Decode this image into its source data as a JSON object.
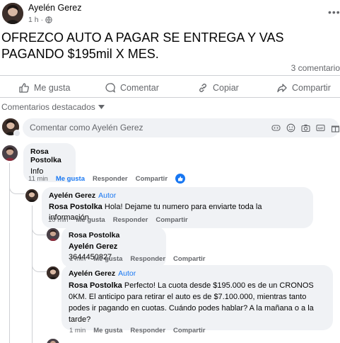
{
  "post": {
    "author": "Ayelén Gerez",
    "time": "1 h",
    "time_separator": "·",
    "text": "OFREZCO AUTO A PAGAR SE ENTREGA Y VAS PAGANDO $195mil X MES.",
    "comment_count": "3 comentario"
  },
  "actions": {
    "like": "Me gusta",
    "comment": "Comentar",
    "copy": "Copiar",
    "share": "Compartir"
  },
  "featured_label": "Comentarios destacados",
  "comment_input": {
    "placeholder": "Comentar como Ayelén Gerez",
    "icons": [
      "sticker-icon",
      "emoji-icon",
      "camera-icon",
      "gif-icon",
      "gift-icon"
    ]
  },
  "comments": [
    {
      "name": "Rosa Postolka",
      "text": "Info",
      "time": "11 min",
      "like": "Me gusta",
      "reply": "Responder",
      "share": "Compartir"
    },
    {
      "name": "Ayelén Gerez",
      "author_tag": "Autor",
      "mention": "Rosa Postolka",
      "text": "Hola! Dejame tu numero para enviarte toda la información.",
      "time": "10 min",
      "like": "Me gusta",
      "reply": "Responder",
      "share": "Compartir"
    },
    {
      "name": "Rosa Postolka",
      "mention": "Ayelén Gerez",
      "text": "3644450827",
      "time": "1 min",
      "like": "Me gusta",
      "reply": "Responder",
      "share": "Compartir"
    },
    {
      "name": "Ayelén Gerez",
      "author_tag": "Autor",
      "mention": "Rosa Postolka",
      "text": "Perfecto! La cuota desde $195.000 es de un CRONOS 0KM. El anticipo para retirar el auto es de $7.100.000, mientras tanto podes ir pagando en cuotas. Cuándo podes hablar? A la mañana o a la tarde?",
      "time": "1 min",
      "like": "Me gusta",
      "reply": "Responder",
      "share": "Compartir"
    }
  ],
  "colors": {
    "link": "#1877f2",
    "secondary_text": "#65676b",
    "bubble": "#f0f2f5"
  }
}
